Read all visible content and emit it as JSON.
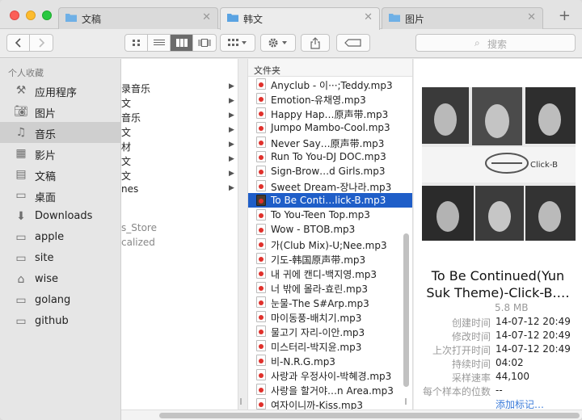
{
  "tabs": [
    {
      "label": "文稿",
      "active": false
    },
    {
      "label": "韩文",
      "active": true
    },
    {
      "label": "图片",
      "active": false
    }
  ],
  "toolbar": {
    "search_placeholder": "搜索",
    "icons": [
      "back-arrow-icon",
      "forward-arrow-icon",
      "icon-view-icon",
      "list-view-icon",
      "column-view-icon",
      "coverflow-view-icon",
      "arrange-icon",
      "gear-icon",
      "share-icon",
      "tag-icon",
      "search-icon"
    ]
  },
  "sidebar": {
    "header": "个人收藏",
    "items": [
      {
        "label": "应用程序",
        "icon": "applications-icon",
        "selected": false
      },
      {
        "label": "图片",
        "icon": "camera-icon",
        "selected": false
      },
      {
        "label": "音乐",
        "icon": "music-note-icon",
        "selected": true
      },
      {
        "label": "影片",
        "icon": "film-icon",
        "selected": false
      },
      {
        "label": "文稿",
        "icon": "document-icon",
        "selected": false
      },
      {
        "label": "桌面",
        "icon": "desktop-icon",
        "selected": false
      },
      {
        "label": "Downloads",
        "icon": "download-icon",
        "selected": false
      },
      {
        "label": "apple",
        "icon": "folder-icon",
        "selected": false
      },
      {
        "label": "site",
        "icon": "folder-icon",
        "selected": false
      },
      {
        "label": "wise",
        "icon": "home-icon",
        "selected": false
      },
      {
        "label": "golang",
        "icon": "folder-icon",
        "selected": false
      },
      {
        "label": "github",
        "icon": "folder-icon",
        "selected": false
      }
    ]
  },
  "column1": {
    "rows": [
      {
        "text": "录音乐"
      },
      {
        "text": "文"
      },
      {
        "text": "音乐"
      },
      {
        "text": "文"
      },
      {
        "text": "材"
      },
      {
        "text": "文"
      },
      {
        "text": "文"
      },
      {
        "text": "nes"
      }
    ],
    "gray": [
      "s_Store",
      "calized"
    ]
  },
  "column2": {
    "header": "文件夹",
    "files": [
      {
        "name": "Anyclub - 이···;Teddy.mp3",
        "selected": false
      },
      {
        "name": "Emotion-유채영.mp3",
        "selected": false
      },
      {
        "name": "Happy Hap…原声带.mp3",
        "selected": false
      },
      {
        "name": "Jumpo Mambo-Cool.mp3",
        "selected": false
      },
      {
        "name": "Never Say…原声带.mp3",
        "selected": false
      },
      {
        "name": "Run To You-DJ DOC.mp3",
        "selected": false
      },
      {
        "name": "Sign-Brow…d Girls.mp3",
        "selected": false
      },
      {
        "name": "Sweet Dream-장나라.mp3",
        "selected": false
      },
      {
        "name": "To Be Conti…lick-B.mp3",
        "selected": true
      },
      {
        "name": "To You-Teen Top.mp3",
        "selected": false
      },
      {
        "name": "Wow - BTOB.mp3",
        "selected": false
      },
      {
        "name": "가(Club Mix)-U;Nee.mp3",
        "selected": false
      },
      {
        "name": "기도-韩国原声带.mp3",
        "selected": false
      },
      {
        "name": "내 귀에 캔디-백지영.mp3",
        "selected": false
      },
      {
        "name": "너 밖에 몰라-효린.mp3",
        "selected": false
      },
      {
        "name": "눈물-The S#Arp.mp3",
        "selected": false
      },
      {
        "name": "마이동풍-배치기.mp3",
        "selected": false
      },
      {
        "name": "물고기 자리-이안.mp3",
        "selected": false
      },
      {
        "name": "미스터리-박지윤.mp3",
        "selected": false
      },
      {
        "name": "비-N.R.G.mp3",
        "selected": false
      },
      {
        "name": "사랑과 우정사이-박혜경.mp3",
        "selected": false
      },
      {
        "name": "사랑을 할거야…n Area.mp3",
        "selected": false
      },
      {
        "name": "여자이니까-Kiss.mp3",
        "selected": false
      }
    ]
  },
  "preview": {
    "album_logo": "Click-B",
    "title_line1": "To Be Continued(Yun",
    "title_line2": "Suk Theme)-Click-B.…",
    "size": "5.8 MB",
    "meta": [
      {
        "key": "创建时间",
        "value": "14-07-12 20:49"
      },
      {
        "key": "修改时间",
        "value": "14-07-12 20:49"
      },
      {
        "key": "上次打开时间",
        "value": "14-07-12 20:49"
      },
      {
        "key": "持续时间",
        "value": "04:02"
      },
      {
        "key": "采样速率",
        "value": "44,100"
      },
      {
        "key": "每个样本的位数",
        "value": "--"
      }
    ],
    "add_tag": "添加标记…"
  },
  "colors": {
    "selection": "#1f5ec8",
    "link": "#3b7bd9"
  }
}
